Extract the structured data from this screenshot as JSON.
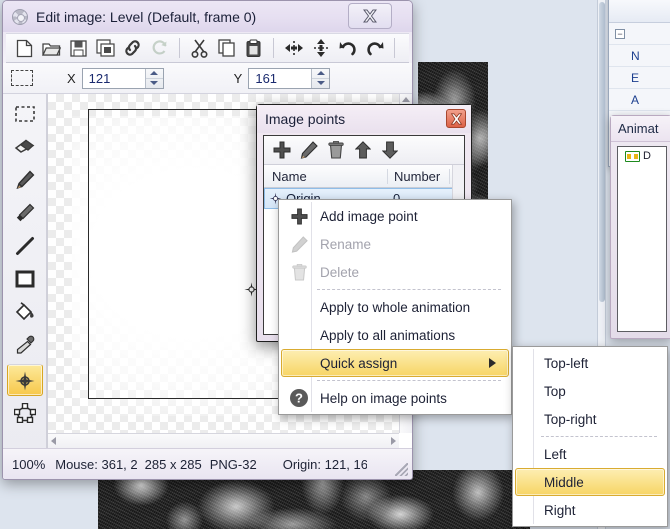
{
  "window": {
    "title": "Edit image: Level (Default, frame 0)",
    "icon": "gear-icon",
    "close_label": "✕"
  },
  "toolbar": {
    "items": [
      {
        "name": "new-file-icon",
        "label": "New"
      },
      {
        "name": "open-folder-icon",
        "label": "Open"
      },
      {
        "name": "save-icon",
        "label": "Save"
      },
      {
        "name": "save-as-icon",
        "label": "Save as"
      },
      {
        "name": "link-icon",
        "label": "Link"
      },
      {
        "name": "refresh-icon",
        "label": "Refresh"
      },
      {
        "name": "cut-scissors-icon",
        "label": "Cut"
      },
      {
        "name": "copy-icon",
        "label": "Copy"
      },
      {
        "name": "paste-icon",
        "label": "Paste"
      },
      {
        "name": "flip-horizontal-icon",
        "label": "Flip horizontal"
      },
      {
        "name": "flip-vertical-icon",
        "label": "Flip vertical"
      },
      {
        "name": "undo-icon",
        "label": "Undo"
      },
      {
        "name": "redo-icon",
        "label": "Redo"
      }
    ]
  },
  "coordbar": {
    "marquee_icon": "marquee-select-icon",
    "x_label": "X",
    "x_value": "121",
    "y_label": "Y",
    "y_value": "161"
  },
  "tools": [
    {
      "name": "tool-rectangular-select",
      "label": "Rectangular select",
      "active": false
    },
    {
      "name": "tool-eraser",
      "label": "Eraser",
      "active": false
    },
    {
      "name": "tool-pencil",
      "label": "Pencil",
      "active": false
    },
    {
      "name": "tool-brush",
      "label": "Brush",
      "active": false
    },
    {
      "name": "tool-line",
      "label": "Line",
      "active": false
    },
    {
      "name": "tool-rectangle",
      "label": "Rectangle",
      "active": false
    },
    {
      "name": "tool-fill-bucket",
      "label": "Fill",
      "active": false
    },
    {
      "name": "tool-color-picker",
      "label": "Color picker",
      "active": false
    },
    {
      "name": "tool-image-point",
      "label": "Image point",
      "active": true
    },
    {
      "name": "tool-polygon",
      "label": "Polygon",
      "active": false
    }
  ],
  "statusbar": {
    "zoom": "100%",
    "mouse": "Mouse: 361, 2",
    "size": "285 x 285",
    "format": "PNG-32",
    "origin": "Origin: 121, 16"
  },
  "image_points_dialog": {
    "title": "Image points",
    "close_label": "✕",
    "toolbar": [
      {
        "name": "add-point-icon",
        "label": "Add"
      },
      {
        "name": "rename-pencil-icon",
        "label": "Rename"
      },
      {
        "name": "delete-trash-icon",
        "label": "Delete"
      },
      {
        "name": "move-up-icon",
        "label": "Move up"
      },
      {
        "name": "move-down-icon",
        "label": "Move down"
      }
    ],
    "columns": [
      "Name",
      "Number"
    ],
    "rows": [
      {
        "icon": "image-point-icon",
        "name": "Origin",
        "number": "0"
      }
    ]
  },
  "context_menu": {
    "items": [
      {
        "label": "Add image point",
        "icon": "plus-icon",
        "disabled": false,
        "highlighted": false,
        "submenu": false
      },
      {
        "label": "Rename",
        "icon": "pencil-icon",
        "disabled": true,
        "highlighted": false,
        "submenu": false
      },
      {
        "label": "Delete",
        "icon": "trash-icon",
        "disabled": true,
        "highlighted": false,
        "submenu": false
      },
      {
        "separator": true
      },
      {
        "label": "Apply to whole animation",
        "icon": "",
        "disabled": false,
        "highlighted": false,
        "submenu": false
      },
      {
        "label": "Apply to all animations",
        "icon": "",
        "disabled": false,
        "highlighted": false,
        "submenu": false
      },
      {
        "label": "Quick assign",
        "icon": "",
        "disabled": false,
        "highlighted": true,
        "submenu": true
      },
      {
        "separator": true
      },
      {
        "label": "Help on image points",
        "icon": "help-icon",
        "disabled": false,
        "highlighted": false,
        "submenu": false
      }
    ]
  },
  "submenu": {
    "items": [
      {
        "label": "Top-left",
        "highlighted": false
      },
      {
        "label": "Top",
        "highlighted": false
      },
      {
        "label": "Top-right",
        "highlighted": false
      },
      {
        "separator": true
      },
      {
        "label": "Left",
        "highlighted": false
      },
      {
        "label": "Middle",
        "highlighted": true
      },
      {
        "label": "Right",
        "highlighted": false
      }
    ]
  },
  "animations_panel": {
    "title": "Animat",
    "items": [
      {
        "icon": "film-strip-icon",
        "label": "D"
      }
    ]
  },
  "background_panel": {
    "rows": [
      "N",
      "E",
      "A"
    ]
  },
  "colors": {
    "highlight": "#f7d565",
    "highlight_border": "#d9ab30",
    "selection_row": "#d5e6f8",
    "close_red": "#dd6247",
    "desktop": "#dde4ee"
  }
}
